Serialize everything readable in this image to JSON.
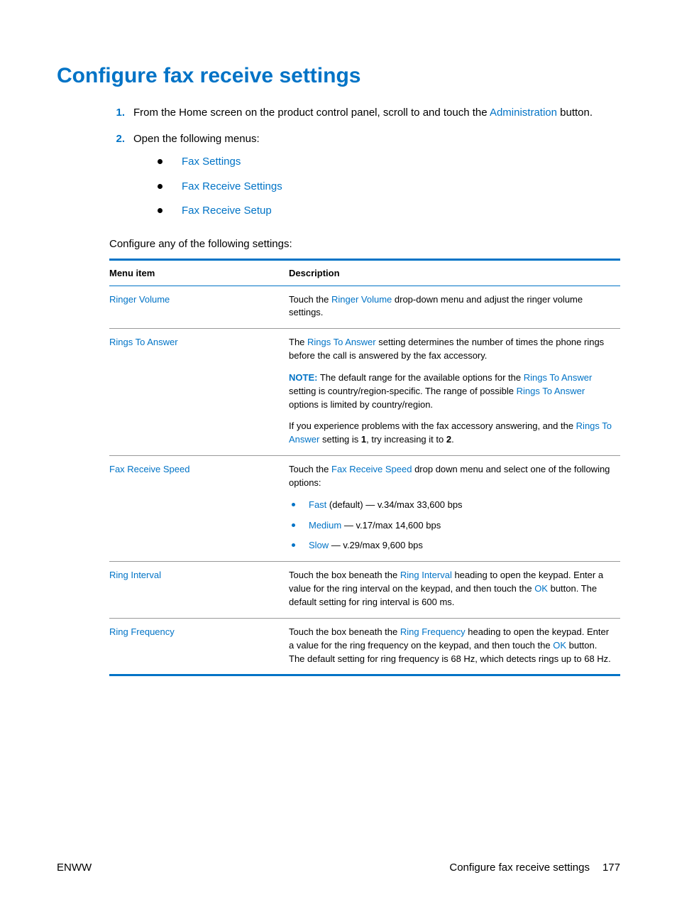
{
  "heading": "Configure fax receive settings",
  "steps": [
    {
      "num": "1.",
      "parts": [
        {
          "t": "From the Home screen on the product control panel, scroll to and touch the "
        },
        {
          "t": "Administration",
          "link": true
        },
        {
          "t": " button."
        }
      ]
    },
    {
      "num": "2.",
      "parts": [
        {
          "t": "Open the following menus:"
        }
      ],
      "sub": [
        "Fax Settings",
        "Fax Receive Settings",
        "Fax Receive Setup"
      ]
    }
  ],
  "intro_after": "Configure any of the following settings:",
  "table": {
    "head": {
      "col1": "Menu item",
      "col2": "Description"
    },
    "rows": [
      {
        "menu": "Ringer Volume",
        "desc": [
          {
            "type": "p",
            "parts": [
              {
                "t": "Touch the "
              },
              {
                "t": "Ringer Volume",
                "link": true
              },
              {
                "t": " drop-down menu and adjust the ringer volume settings."
              }
            ]
          }
        ]
      },
      {
        "menu": "Rings To Answer",
        "desc": [
          {
            "type": "p",
            "parts": [
              {
                "t": "The "
              },
              {
                "t": "Rings To Answer",
                "link": true
              },
              {
                "t": " setting determines the number of times the phone rings before the call is answered by the fax accessory."
              }
            ]
          },
          {
            "type": "p",
            "parts": [
              {
                "t": "NOTE:",
                "note": true
              },
              {
                "t": "   The default range for the available options for the "
              },
              {
                "t": "Rings To Answer",
                "link": true
              },
              {
                "t": " setting is country/region-specific. The range of possible "
              },
              {
                "t": "Rings To Answer",
                "link": true
              },
              {
                "t": " options is limited by country/region."
              }
            ]
          },
          {
            "type": "p",
            "parts": [
              {
                "t": "If you experience problems with the fax accessory answering, and the "
              },
              {
                "t": "Rings To Answer",
                "link": true
              },
              {
                "t": " setting is "
              },
              {
                "t": "1",
                "bold": true
              },
              {
                "t": ", try increasing it to "
              },
              {
                "t": "2",
                "bold": true
              },
              {
                "t": "."
              }
            ]
          }
        ]
      },
      {
        "menu": "Fax Receive Speed",
        "desc": [
          {
            "type": "p",
            "parts": [
              {
                "t": "Touch the "
              },
              {
                "t": "Fax Receive Speed",
                "link": true
              },
              {
                "t": " drop down menu and select one of the following options:"
              }
            ]
          },
          {
            "type": "ul",
            "items": [
              [
                {
                  "t": "Fast",
                  "link": true
                },
                {
                  "t": " (default) — v.34/max 33,600 bps"
                }
              ],
              [
                {
                  "t": "Medium",
                  "link": true
                },
                {
                  "t": " — v.17/max 14,600 bps"
                }
              ],
              [
                {
                  "t": "Slow",
                  "link": true
                },
                {
                  "t": " — v.29/max 9,600 bps"
                }
              ]
            ]
          }
        ]
      },
      {
        "menu": "Ring Interval",
        "desc": [
          {
            "type": "p",
            "parts": [
              {
                "t": "Touch the box beneath the "
              },
              {
                "t": "Ring Interval",
                "link": true
              },
              {
                "t": " heading to open the keypad. Enter a value for the ring interval on the keypad, and then touch the "
              },
              {
                "t": "OK",
                "link": true
              },
              {
                "t": " button. The default setting for ring interval is 600 ms."
              }
            ]
          }
        ]
      },
      {
        "menu": "Ring Frequency",
        "desc": [
          {
            "type": "p",
            "parts": [
              {
                "t": "Touch the box beneath the "
              },
              {
                "t": "Ring Frequency",
                "link": true
              },
              {
                "t": " heading to open the keypad. Enter a value for the ring frequency on the keypad, and then touch the "
              },
              {
                "t": "OK",
                "link": true
              },
              {
                "t": " button. The default setting for ring frequency is 68 Hz, which detects rings up to 68 Hz."
              }
            ]
          }
        ]
      }
    ]
  },
  "footer": {
    "left": "ENWW",
    "right_title": "Configure fax receive settings",
    "page": "177"
  }
}
